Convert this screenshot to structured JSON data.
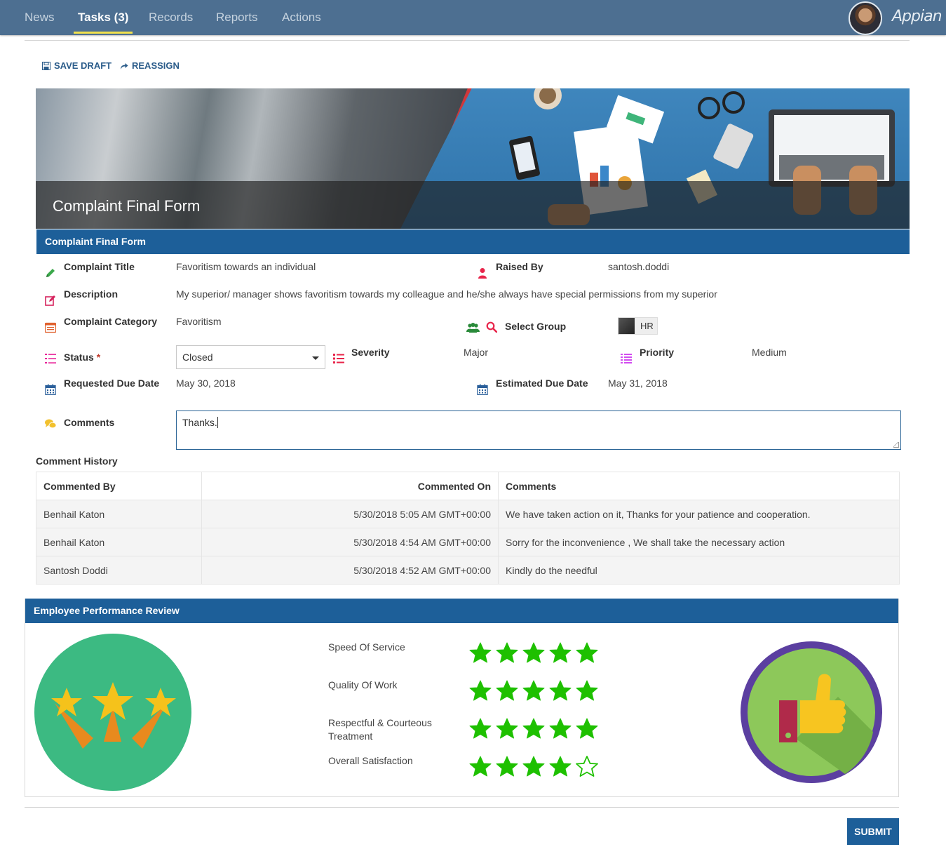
{
  "nav": {
    "tabs": [
      {
        "label": "News"
      },
      {
        "label": "Tasks (3)"
      },
      {
        "label": "Records"
      },
      {
        "label": "Reports"
      },
      {
        "label": "Actions"
      }
    ],
    "active_tab": "Tasks (3)",
    "brand": "Appian"
  },
  "toolbar": {
    "save_draft": "SAVE DRAFT",
    "reassign": "REASSIGN"
  },
  "banner": {
    "title": "Complaint Final Form"
  },
  "form": {
    "section_title": "Complaint Final Form",
    "complaint_title_label": "Complaint Title",
    "complaint_title_value": "Favoritism towards an individual",
    "raised_by_label": "Raised By",
    "raised_by_value": "santosh.doddi",
    "description_label": "Description",
    "description_value": "My superior/ manager shows favoritism towards my colleague and he/she always have special permissions from my superior",
    "category_label": "Complaint Category",
    "category_value": "Favoritism",
    "select_group_label": "Select Group",
    "select_group_value": "HR",
    "status_label": "Status",
    "status_required": "*",
    "status_value": "Closed",
    "severity_label": "Severity",
    "severity_value": "Major",
    "priority_label": "Priority",
    "priority_value": "Medium",
    "requested_due_label": "Requested Due Date",
    "requested_due_value": "May 30, 2018",
    "estimated_due_label": "Estimated Due Date",
    "estimated_due_value": "May 31, 2018",
    "comments_label": "Comments",
    "comments_value": "Thanks."
  },
  "history": {
    "title": "Comment History",
    "columns": [
      "Commented By",
      "Commented On",
      "Comments"
    ],
    "rows": [
      {
        "by": "Benhail Katon",
        "on": "5/30/2018 5:05 AM GMT+00:00",
        "comment": "We have taken action on it, Thanks for your patience and cooperation."
      },
      {
        "by": "Benhail Katon",
        "on": "5/30/2018 4:54 AM GMT+00:00",
        "comment": "Sorry for the inconvenience , We shall take the necessary action"
      },
      {
        "by": "Santosh Doddi",
        "on": "5/30/2018 4:52 AM GMT+00:00",
        "comment": "Kindly do the needful"
      }
    ]
  },
  "performance": {
    "title": "Employee Performance Review",
    "ratings": [
      {
        "label": "Speed Of Service",
        "value": 5,
        "max": 5
      },
      {
        "label": "Quality Of Work",
        "value": 5,
        "max": 5
      },
      {
        "label": "Respectful & Courteous Treatment",
        "value": 5,
        "max": 5
      },
      {
        "label": "Overall Satisfaction",
        "value": 4,
        "max": 5
      }
    ],
    "star_color": "#1ec000"
  },
  "actions": {
    "submit": "SUBMIT"
  }
}
